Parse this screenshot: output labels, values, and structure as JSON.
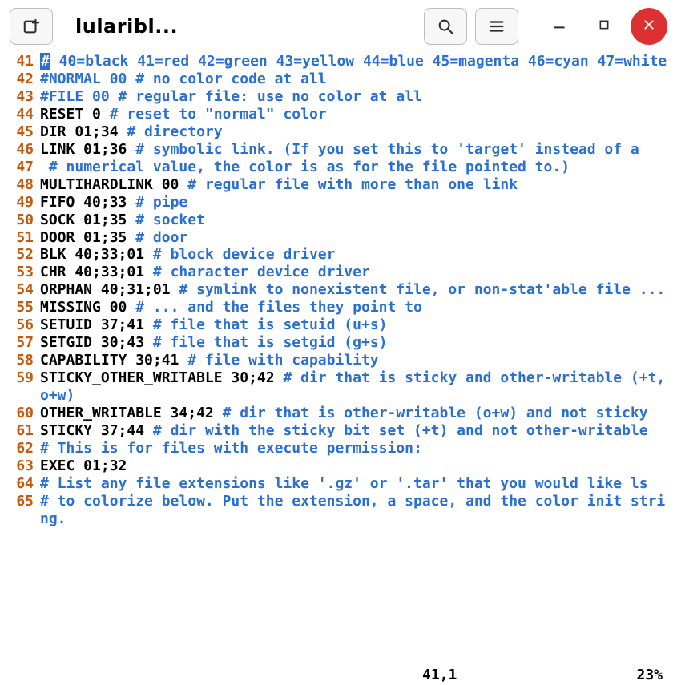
{
  "header": {
    "title": "lularibl...",
    "newtab_icon": "new-tab-icon",
    "search_icon": "search-icon",
    "menu_icon": "hamburger-icon",
    "minimize_icon": "minimize-icon",
    "maximize_icon": "maximize-icon",
    "close_icon": "close-icon"
  },
  "status": {
    "position": "41,1",
    "percent": "23%"
  },
  "lines": [
    {
      "num": "41",
      "segs": [
        [
          "cursor",
          "#"
        ],
        [
          "cm",
          " 40=black 41=red 42=green 43=yellow 44=blue 45=magenta 46=cyan 47=white"
        ]
      ]
    },
    {
      "num": "42",
      "segs": [
        [
          "cm",
          "#NORMAL 00 # no color code at all"
        ]
      ]
    },
    {
      "num": "43",
      "segs": [
        [
          "cm",
          "#FILE 00 # regular file: use no color at all"
        ]
      ]
    },
    {
      "num": "44",
      "segs": [
        [
          "kw",
          "RESET 0 "
        ],
        [
          "cm",
          "# reset to \"normal\" color"
        ]
      ]
    },
    {
      "num": "45",
      "segs": [
        [
          "kw",
          "DIR 01;34 "
        ],
        [
          "cm",
          "# directory"
        ]
      ]
    },
    {
      "num": "46",
      "segs": [
        [
          "kw",
          "LINK 01;36 "
        ],
        [
          "cm",
          "# symbolic link. (If you set this to 'target' instead of a"
        ]
      ]
    },
    {
      "num": "47",
      "segs": [
        [
          "kw",
          " "
        ],
        [
          "cm",
          "# numerical value, the color is as for the file pointed to.)"
        ]
      ]
    },
    {
      "num": "48",
      "segs": [
        [
          "kw",
          "MULTIHARDLINK 00 "
        ],
        [
          "cm",
          "# regular file with more than one link"
        ]
      ]
    },
    {
      "num": "49",
      "segs": [
        [
          "kw",
          "FIFO 40;33 "
        ],
        [
          "cm",
          "# pipe"
        ]
      ]
    },
    {
      "num": "50",
      "segs": [
        [
          "kw",
          "SOCK 01;35 "
        ],
        [
          "cm",
          "# socket"
        ]
      ]
    },
    {
      "num": "51",
      "segs": [
        [
          "kw",
          "DOOR 01;35 "
        ],
        [
          "cm",
          "# door"
        ]
      ]
    },
    {
      "num": "52",
      "segs": [
        [
          "kw",
          "BLK 40;33;01 "
        ],
        [
          "cm",
          "# block device driver"
        ]
      ]
    },
    {
      "num": "53",
      "segs": [
        [
          "kw",
          "CHR 40;33;01 "
        ],
        [
          "cm",
          "# character device driver"
        ]
      ]
    },
    {
      "num": "54",
      "segs": [
        [
          "kw",
          "ORPHAN 40;31;01 "
        ],
        [
          "cm",
          "# symlink to nonexistent file, or non-stat'able file ..."
        ]
      ]
    },
    {
      "num": "55",
      "segs": [
        [
          "kw",
          "MISSING 00 "
        ],
        [
          "cm",
          "# ... and the files they point to"
        ]
      ]
    },
    {
      "num": "56",
      "segs": [
        [
          "kw",
          "SETUID 37;41 "
        ],
        [
          "cm",
          "# file that is setuid (u+s)"
        ]
      ]
    },
    {
      "num": "57",
      "segs": [
        [
          "kw",
          "SETGID 30;43 "
        ],
        [
          "cm",
          "# file that is setgid (g+s)"
        ]
      ]
    },
    {
      "num": "58",
      "segs": [
        [
          "kw",
          "CAPABILITY 30;41 "
        ],
        [
          "cm",
          "# file with capability"
        ]
      ]
    },
    {
      "num": "59",
      "segs": [
        [
          "kw",
          "STICKY_OTHER_WRITABLE 30;42 "
        ],
        [
          "cm",
          "# dir that is sticky and other-writable (+t,o+w)"
        ]
      ]
    },
    {
      "num": "60",
      "segs": [
        [
          "kw",
          "OTHER_WRITABLE 34;42 "
        ],
        [
          "cm",
          "# dir that is other-writable (o+w) and not sticky"
        ]
      ]
    },
    {
      "num": "61",
      "segs": [
        [
          "kw",
          "STICKY 37;44 "
        ],
        [
          "cm",
          "# dir with the sticky bit set (+t) and not other-writable"
        ]
      ]
    },
    {
      "num": "62",
      "segs": [
        [
          "cm",
          "# This is for files with execute permission:"
        ]
      ]
    },
    {
      "num": "63",
      "segs": [
        [
          "kw",
          "EXEC 01;32"
        ]
      ]
    },
    {
      "num": "64",
      "segs": [
        [
          "cm",
          "# List any file extensions like '.gz' or '.tar' that you would like ls"
        ]
      ]
    },
    {
      "num": "65",
      "segs": [
        [
          "cm",
          "# to colorize below. Put the extension, a space, and the color init string."
        ]
      ]
    }
  ]
}
